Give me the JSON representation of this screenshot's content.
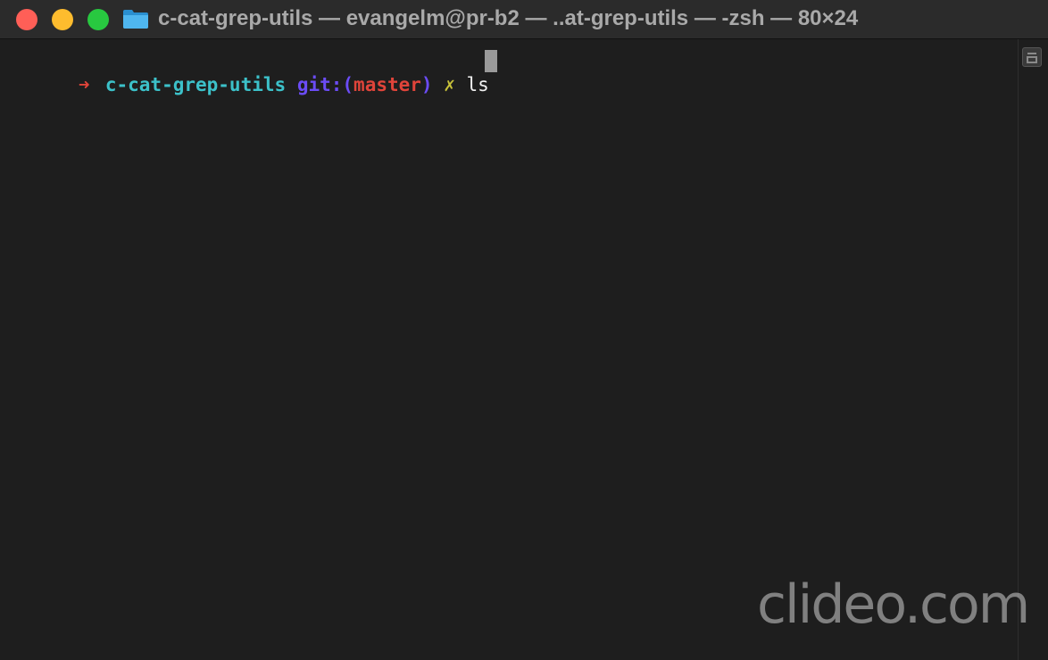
{
  "window": {
    "title": "c-cat-grep-utils — evangelm@pr-b2 — ..at-grep-utils — -zsh — 80×24",
    "folder_icon": "folder-icon"
  },
  "traffic_lights": {
    "close_color": "#ff5f57",
    "minimize_color": "#febc2e",
    "zoom_color": "#28c840"
  },
  "prompt": {
    "arrow": "➜",
    "directory": "c-cat-grep-utils",
    "git_prefix": "git:",
    "paren_open": "(",
    "branch": "master",
    "paren_close": ")",
    "dirty_marker": "✗",
    "command": "ls"
  },
  "colors": {
    "arrow": "#e0443a",
    "directory": "#3cc1c9",
    "git": "#6b4cf6",
    "branch": "#e0443a",
    "dirty": "#c8c23a",
    "command": "#f2f2f2",
    "cursor": "#9a9a9a",
    "background": "#1e1e1e",
    "titlebar": "#2b2b2b",
    "folder": "#39a8e8"
  },
  "watermark": {
    "text": "clideo.com"
  }
}
